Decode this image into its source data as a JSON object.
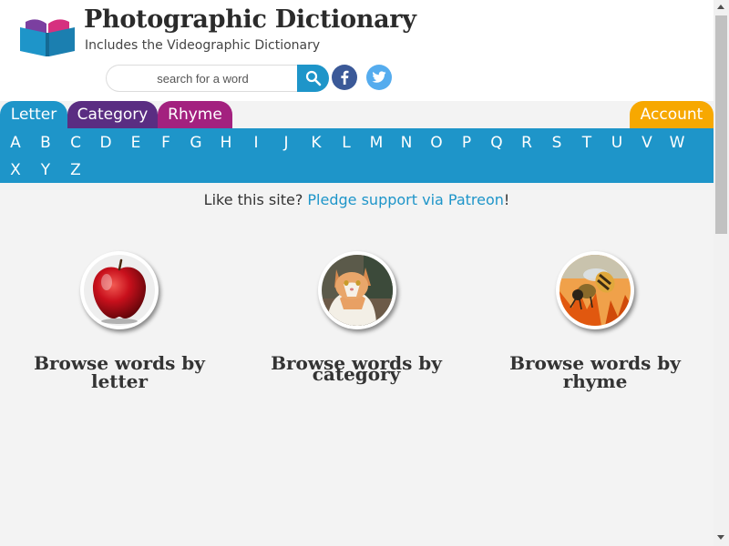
{
  "header": {
    "title": "Photographic Dictionary",
    "subtitle": "Includes the Videographic Dictionary",
    "logo_icon": "book-icon"
  },
  "search": {
    "placeholder": "search for a word",
    "button_icon": "search-icon"
  },
  "social": [
    {
      "name": "facebook-icon",
      "color": "#3b5998"
    },
    {
      "name": "twitter-icon",
      "color": "#55acee"
    }
  ],
  "tabs": {
    "letter": "Letter",
    "category": "Category",
    "rhyme": "Rhyme",
    "account": "Account"
  },
  "letters": [
    "A",
    "B",
    "C",
    "D",
    "E",
    "F",
    "G",
    "H",
    "I",
    "J",
    "K",
    "L",
    "M",
    "N",
    "O",
    "P",
    "Q",
    "R",
    "S",
    "T",
    "U",
    "V",
    "W",
    "X",
    "Y",
    "Z"
  ],
  "pledge": {
    "prefix": "Like this site? ",
    "link": "Pledge support via Patreon",
    "suffix": "!"
  },
  "browse": {
    "letter_label": "Browse words by letter",
    "category_label_1": "Browse words by",
    "category_label_2": "category",
    "rhyme_label": "Browse words by rhyme"
  },
  "colors": {
    "blue": "#1e95c9",
    "purple": "#5a2d82",
    "magenta": "#a3217f",
    "orange": "#f7a800",
    "background": "#f3f3f3"
  }
}
